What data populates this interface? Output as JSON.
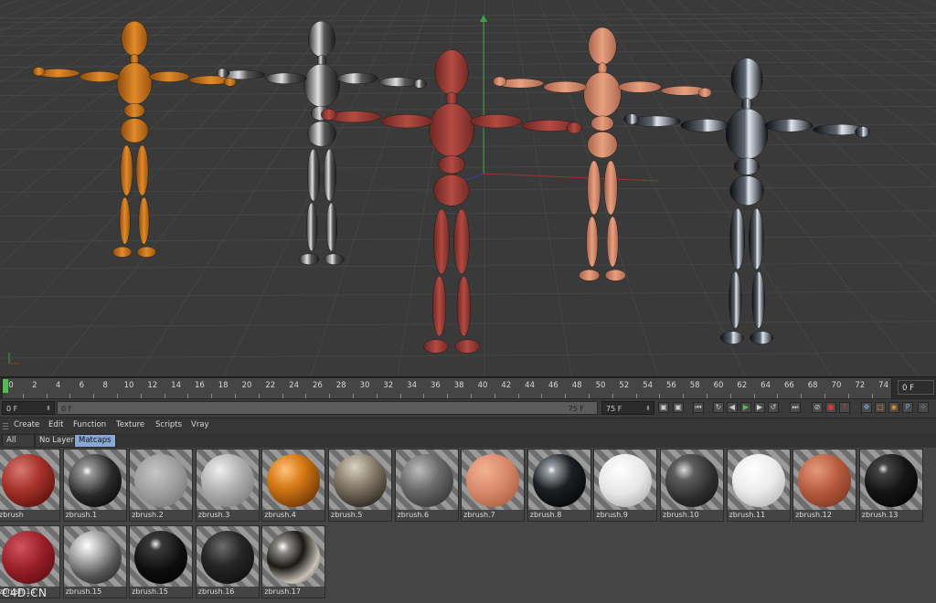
{
  "viewport": {
    "figures": [
      {
        "name": "orange-mannequin",
        "color": "#cf7a1e"
      },
      {
        "name": "chrome-mannequin",
        "color": "#9c9c9c"
      },
      {
        "name": "red-mannequin",
        "color": "#a8413a"
      },
      {
        "name": "peach-mannequin",
        "color": "#d98e6c"
      },
      {
        "name": "glass-mannequin",
        "color": "#2c3138"
      }
    ]
  },
  "timeline": {
    "ticks": [
      "0",
      "2",
      "4",
      "6",
      "8",
      "10",
      "12",
      "14",
      "16",
      "18",
      "20",
      "22",
      "24",
      "26",
      "28",
      "30",
      "32",
      "34",
      "36",
      "38",
      "40",
      "42",
      "44",
      "46",
      "48",
      "50",
      "52",
      "54",
      "56",
      "58",
      "60",
      "62",
      "64",
      "66",
      "68",
      "70",
      "72",
      "74"
    ],
    "current_frame": "0 F"
  },
  "controls": {
    "start_frame": "0 F",
    "range_start": "0 F",
    "range_end": "75 F",
    "end_frame": "75 F"
  },
  "menu": {
    "items": [
      "Create",
      "Edit",
      "Function",
      "Texture",
      "Scripts",
      "Vray"
    ]
  },
  "filters": {
    "tabs": [
      "All",
      "No Layer",
      "Matcaps"
    ],
    "active": "Matcaps"
  },
  "materials": [
    {
      "label": "zbrush",
      "style": "red"
    },
    {
      "label": "zbrush.1",
      "style": "chrome-dark"
    },
    {
      "label": "zbrush.2",
      "style": "grey-matte"
    },
    {
      "label": "zbrush.3",
      "style": "grey-light"
    },
    {
      "label": "zbrush.4",
      "style": "orange"
    },
    {
      "label": "zbrush.5",
      "style": "bronze-dark"
    },
    {
      "label": "zbrush.6",
      "style": "grey-mid"
    },
    {
      "label": "zbrush.7",
      "style": "peach"
    },
    {
      "label": "zbrush.8",
      "style": "glass"
    },
    {
      "label": "zbrush.9",
      "style": "white"
    },
    {
      "label": "zbrush.10",
      "style": "dark-grey"
    },
    {
      "label": "zbrush.11",
      "style": "white-soft"
    },
    {
      "label": "zbrush.12",
      "style": "terracotta"
    },
    {
      "label": "zbrush.13",
      "style": "black-gloss"
    },
    {
      "label": "zbrush.14",
      "style": "deep-red"
    },
    {
      "label": "zbrush.15",
      "style": "silver"
    },
    {
      "label": "zbrush.15",
      "style": "black-shine"
    },
    {
      "label": "zbrush.16",
      "style": "black-matte"
    },
    {
      "label": "zbrush.17",
      "style": "chrome-env"
    }
  ],
  "watermark": "C4D.CN"
}
